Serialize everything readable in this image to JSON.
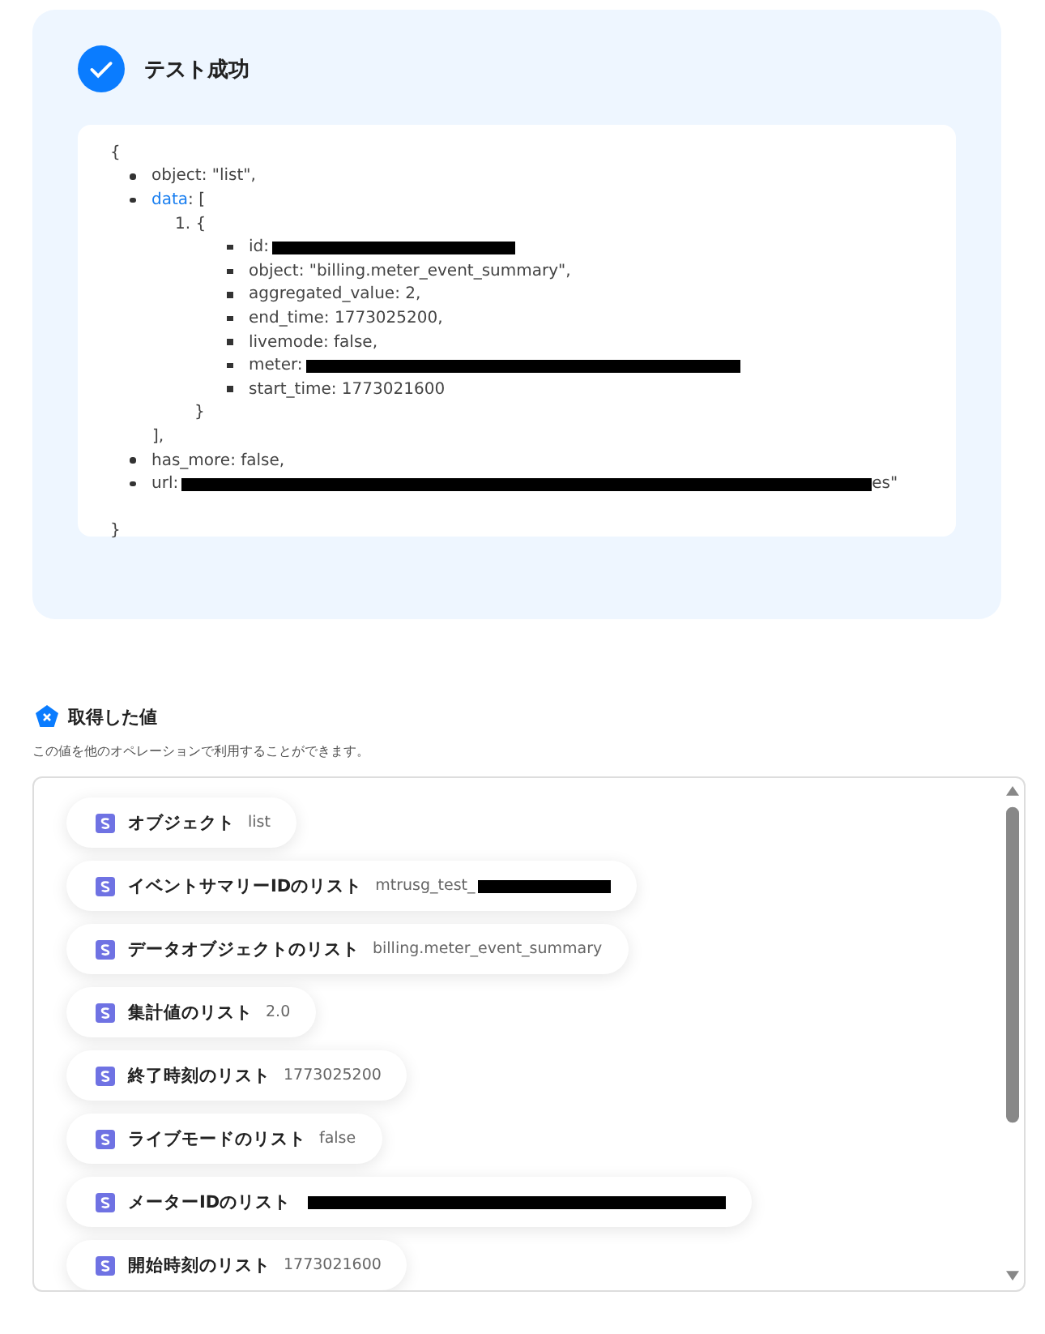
{
  "result": {
    "title": "テスト成功",
    "code": {
      "open": "{",
      "close": "}",
      "items": [
        {
          "kind": "line",
          "text": "object: \"list\",",
          "redacted": false
        },
        {
          "kind": "array",
          "key": "data",
          "open": ": [",
          "close": "],",
          "entries": [
            {
              "number": "1.",
              "open": "{",
              "close": "}",
              "items": [
                {
                  "text": "id: ",
                  "redacted": true
                },
                {
                  "text": "object: \"billing.meter_event_summary\",",
                  "redacted": false
                },
                {
                  "text": "aggregated_value: 2,",
                  "redacted": false
                },
                {
                  "text": "end_time: 1773025200,",
                  "redacted": false
                },
                {
                  "text": "livemode: false,",
                  "redacted": false
                },
                {
                  "text": "meter: ",
                  "redacted": true
                },
                {
                  "text": "start_time: 1773021600",
                  "redacted": false
                }
              ]
            }
          ]
        },
        {
          "kind": "line",
          "text": "has_more: false,",
          "redacted": false
        },
        {
          "kind": "line",
          "text": "url: ",
          "redacted": true,
          "tail": "es\""
        }
      ]
    }
  },
  "values": {
    "title": "取得した値",
    "description": "この値を他のオペレーションで利用することができます。",
    "items": [
      {
        "label": "オブジェクト",
        "value": "list",
        "redacted": false
      },
      {
        "label": "イベントサマリーIDのリスト",
        "value": "mtrusg_test_",
        "redacted": true
      },
      {
        "label": "データオブジェクトのリスト",
        "value": "billing.meter_event_summary",
        "redacted": false
      },
      {
        "label": "集計値のリスト",
        "value": "2.0",
        "redacted": false
      },
      {
        "label": "終了時刻のリスト",
        "value": "1773025200",
        "redacted": false
      },
      {
        "label": "ライブモードのリスト",
        "value": "false",
        "redacted": false
      },
      {
        "label": "メーターIDのリスト",
        "redacted": true
      },
      {
        "label": "開始時刻のリスト",
        "value": "1773021600",
        "redacted": false
      }
    ]
  }
}
